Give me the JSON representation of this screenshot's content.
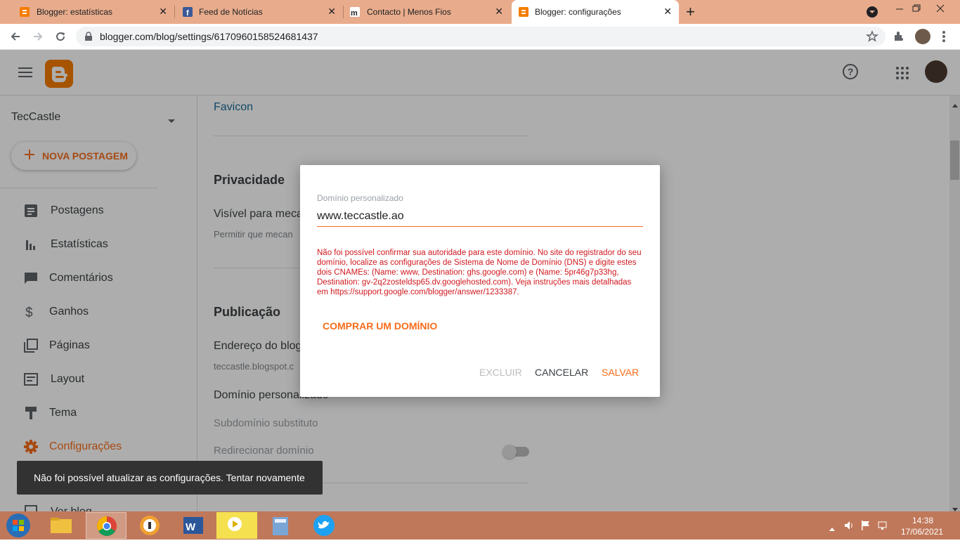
{
  "browser": {
    "tabs": [
      {
        "title": "Blogger: estatísticas",
        "favicon": "blogger-icon",
        "active": false
      },
      {
        "title": "Feed de Notícias",
        "favicon": "facebook-icon",
        "active": false
      },
      {
        "title": "Contacto | Menos Fios",
        "favicon": "menosfios-icon",
        "active": false
      },
      {
        "title": "Blogger: configurações",
        "favicon": "blogger-icon",
        "active": true
      }
    ],
    "close_glyph": "✕",
    "new_tab_glyph": "+",
    "url": "blogger.com/blog/settings/6170960158524681437"
  },
  "blog": {
    "name": "TecCastle",
    "new_post_label": "NOVA POSTAGEM"
  },
  "sidebar": {
    "items": [
      {
        "label": "Postagens",
        "icon": "posts-icon"
      },
      {
        "label": "Estatísticas",
        "icon": "stats-icon"
      },
      {
        "label": "Comentários",
        "icon": "comments-icon"
      },
      {
        "label": "Ganhos",
        "icon": "dollar-icon"
      },
      {
        "label": "Páginas",
        "icon": "pages-icon"
      },
      {
        "label": "Layout",
        "icon": "layout-icon"
      },
      {
        "label": "Tema",
        "icon": "theme-icon"
      },
      {
        "label": "Configurações",
        "icon": "gear-icon",
        "active": true
      }
    ],
    "partial_item": "Ver blog"
  },
  "main": {
    "favicon_link": "Favicon",
    "privacy_heading": "Privacidade",
    "visible_label": "Visível para meca",
    "visible_desc": "Permitir que mecan",
    "publishing_heading": "Publicação",
    "blog_address_label": "Endereço do blog",
    "blog_address_value": "teccastle.blogspot.c",
    "custom_domain_label": "Domínio personalizado",
    "fallback_subdomain": "Subdomínio substituto",
    "redirect_domain": "Redirecionar domínio"
  },
  "dialog": {
    "field_label": "Domínio personalizado",
    "field_value": "www.teccastle.ao",
    "error_text": "Não foi possível confirmar sua autoridade para este domínio. No site do registrador do seu domínio, localize as configurações de Sistema de Nome de Domínio (DNS) e digite estes dois CNAMEs: (Name: www, Destination: ghs.google.com) e (Name: 5pr46g7p33hg, Destination: gv-2q2zosteldsp65.dv.googlehosted.com). Veja instruções mais detalhadas em https://support.google.com/blogger/answer/1233387.",
    "buy_domain": "COMPRAR UM DOMÍNIO",
    "delete": "EXCLUIR",
    "cancel": "CANCELAR",
    "save": "SALVAR"
  },
  "snackbar": {
    "message": "Não foi possível atualizar as configurações. Tentar novamente"
  },
  "taskbar": {
    "time": "14:38",
    "date": "17/06/2021"
  },
  "colors": {
    "accent": "#f76d1b",
    "error": "#d0181e",
    "link": "#1a73e8",
    "tabstrip": "#e8ac8c",
    "taskbar": "#c0785a"
  }
}
